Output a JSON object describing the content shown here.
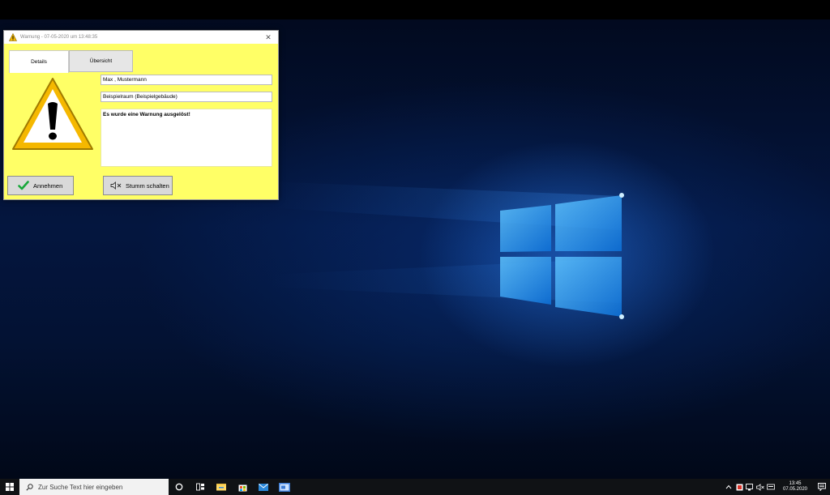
{
  "window": {
    "title": "Warnung - 07-05-2020 um 13:48:35",
    "tabs": [
      {
        "label": "Details"
      },
      {
        "label": "Übersicht"
      }
    ],
    "person": "Max , Mustermann",
    "room": "Beispielraum (Beispielgebäude)",
    "message": "Es wurde eine Warnung ausgelöst!",
    "accept_label": "Annehmen",
    "mute_label": "Stumm schalten",
    "background_color": "#ffff66"
  },
  "taskbar": {
    "search_placeholder": "Zur Suche Text hier eingeben",
    "apps": [
      "cortana-icon",
      "task-view-icon",
      "file-explorer-icon",
      "store-icon",
      "mail-icon",
      "app-icon"
    ],
    "clock_time": "13:45",
    "clock_date": "07.05.2020"
  }
}
